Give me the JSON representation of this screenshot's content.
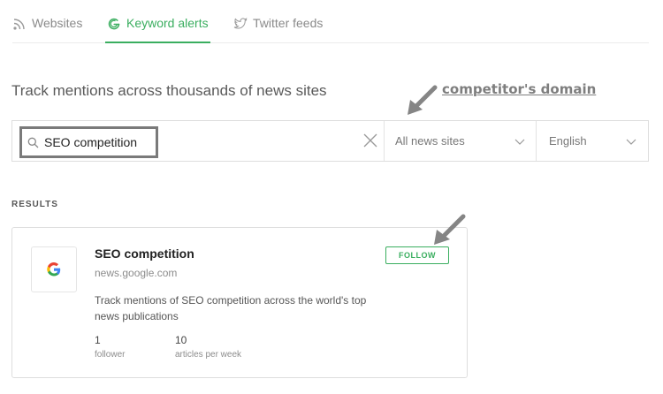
{
  "tabs": [
    {
      "label": "Websites",
      "icon": "rss-icon",
      "active": false
    },
    {
      "label": "Keyword alerts",
      "icon": "google-g-icon",
      "active": true
    },
    {
      "label": "Twitter feeds",
      "icon": "twitter-bird-icon",
      "active": false
    }
  ],
  "headline": "Track mentions across thousands of news sites",
  "annotation": {
    "label": "competitor's domain"
  },
  "search": {
    "value": "SEO competition",
    "icon": "search-icon",
    "clear_icon": "close-icon",
    "source_select": "All news sites",
    "language_select": "English"
  },
  "results": {
    "label": "RESULTS",
    "card": {
      "title": "SEO competition",
      "domain": "news.google.com",
      "description": "Track mentions of SEO competition across the world's top news publications",
      "followers_count": "1",
      "followers_label": "follower",
      "articles_count": "10",
      "articles_label": "articles per week",
      "follow_label": "FOLLOW"
    }
  },
  "colors": {
    "accent": "#3aae5f",
    "annotation": "#7e7e7e",
    "border": "#dedede"
  }
}
